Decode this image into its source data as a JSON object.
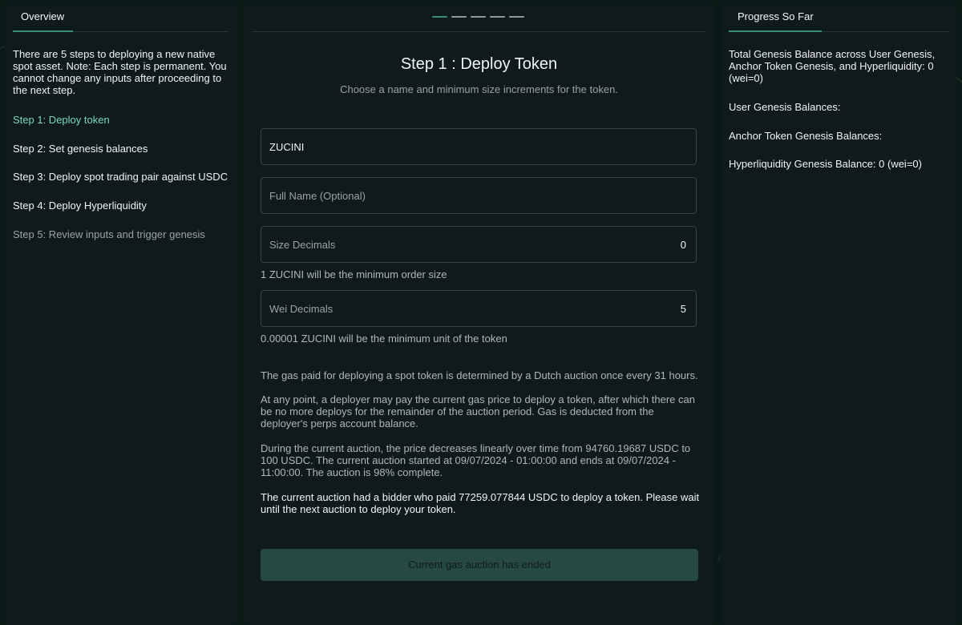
{
  "overview": {
    "tab_label": "Overview",
    "intro": "There are 5 steps to deploying a new native spot asset. Note: Each step is permanent. You cannot change any inputs after proceeding to the next step.",
    "steps": [
      {
        "label": "Step 1: Deploy token",
        "state": "active"
      },
      {
        "label": "Step 2: Set genesis balances",
        "state": "done"
      },
      {
        "label": "Step 3: Deploy spot trading pair against USDC",
        "state": "done"
      },
      {
        "label": "Step 4: Deploy Hyperliquidity",
        "state": "done"
      },
      {
        "label": "Step 5: Review inputs and trigger genesis",
        "state": "muted"
      }
    ]
  },
  "step": {
    "current": 1,
    "total": 5,
    "title": "Step 1 : Deploy Token",
    "subtitle": "Choose a name and minimum size increments for the token."
  },
  "form": {
    "token_name_value": "ZUCINI",
    "full_name_placeholder": "Full Name (Optional)",
    "size_decimals_label": "Size Decimals",
    "size_decimals_value": "0",
    "size_hint": "1 ZUCINI will be the minimum order size",
    "wei_decimals_label": "Wei Decimals",
    "wei_decimals_value": "5",
    "wei_hint": "0.00001 ZUCINI will be the minimum unit of the token"
  },
  "auction": {
    "p1": "The gas paid for deploying a spot token is determined by a Dutch auction once every 31 hours.",
    "p2": "At any point, a deployer may pay the current gas price to deploy a token, after which there can be no more deploys for the remainder of the auction period. Gas is deducted from the deployer's perps account balance.",
    "p3": "During the current auction, the price decreases linearly over time from 94760.19687 USDC to 100 USDC. The current auction started at 09/07/2024 - 01:00:00 and ends at 09/07/2024 - 11:00:00. The auction is 98% complete.",
    "p4": "The current auction had a bidder who paid 77259.077844 USDC to deploy a token. Please wait until the next auction to deploy your token.",
    "button_label": "Current gas auction has ended"
  },
  "progress": {
    "tab_label": "Progress So Far",
    "total_genesis": "Total Genesis Balance across User Genesis, Anchor Token Genesis, and Hyperliquidity: 0 (wei=0)",
    "user_genesis": "User Genesis Balances:",
    "anchor_genesis": "Anchor Token Genesis Balances:",
    "hyperliquidity_genesis": "Hyperliquidity Genesis Balance: 0 (wei=0)"
  },
  "colors": {
    "accent": "#3c8d76",
    "active_step": "#78d9c2",
    "panel_bg": "#0f1a1d",
    "page_bg": "#0b1a16",
    "button_bg": "#264a42"
  }
}
